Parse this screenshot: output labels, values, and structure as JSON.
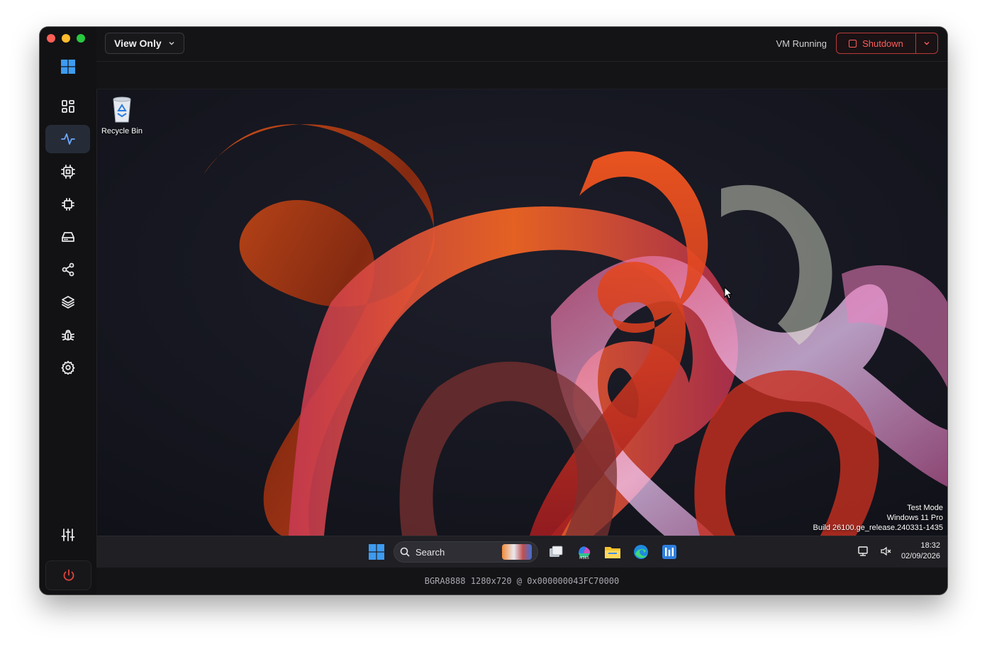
{
  "topbar": {
    "view_mode": "View Only",
    "vm_status": "VM Running",
    "shutdown_label": "Shutdown"
  },
  "sidebar": {
    "items": [
      {
        "icon": "dashboard-icon",
        "active": false
      },
      {
        "icon": "activity-icon",
        "active": true
      },
      {
        "icon": "cpu-icon",
        "active": false
      },
      {
        "icon": "chip-icon",
        "active": false
      },
      {
        "icon": "storage-icon",
        "active": false
      },
      {
        "icon": "share-icon",
        "active": false
      },
      {
        "icon": "layers-icon",
        "active": false
      },
      {
        "icon": "bug-icon",
        "active": false
      },
      {
        "icon": "settings-icon",
        "active": false
      }
    ],
    "bottom": [
      "sliders-icon",
      "power-icon"
    ]
  },
  "desktop": {
    "icons": [
      {
        "label": "Recycle Bin",
        "icon": "recycle-bin-icon"
      }
    ],
    "watermark": {
      "line1": "Test Mode",
      "line2": "Windows 11 Pro",
      "line3": "Build 26100.ge_release.240331-1435"
    }
  },
  "taskbar": {
    "search_placeholder": "Search",
    "apps": [
      "task-view-icon",
      "m365-copilot-icon",
      "file-explorer-icon",
      "edge-icon",
      "store-icon"
    ],
    "time": "18:32",
    "date": "02/09/2026"
  },
  "statusbar": {
    "text": "BGRA8888 1280x720 @ 0x000000043FC70000"
  },
  "colors": {
    "accent_blue": "#6aa8ff",
    "danger": "#ff5c5c",
    "window_bg": "#141416"
  }
}
